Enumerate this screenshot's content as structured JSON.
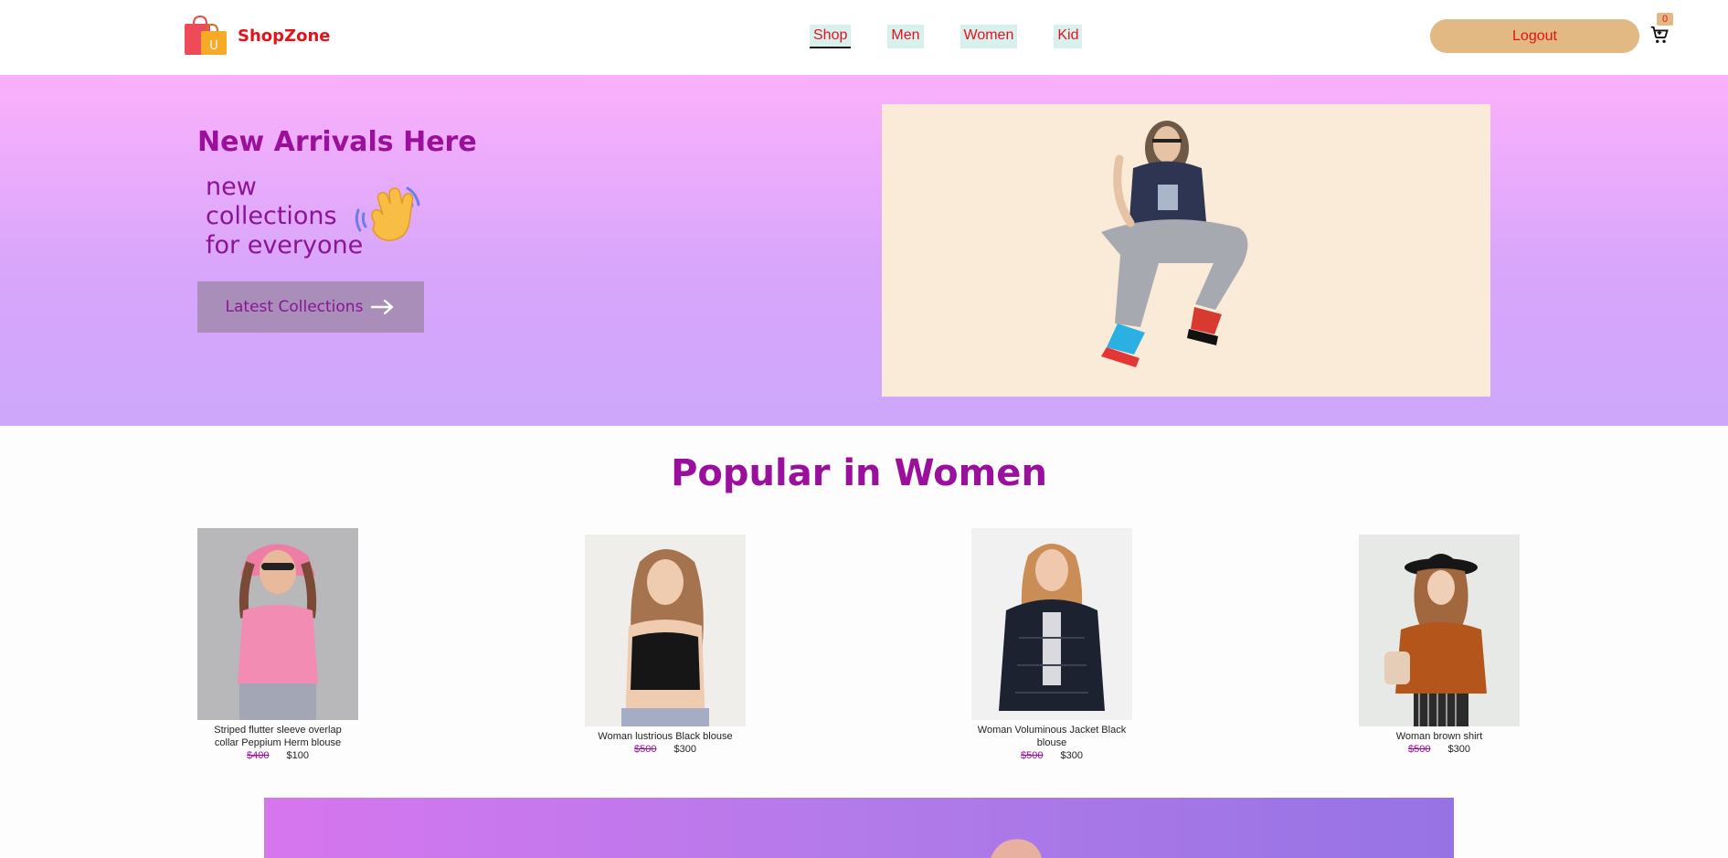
{
  "brand": {
    "name": "ShopZone",
    "logo_letter": "U"
  },
  "nav": {
    "items": [
      {
        "label": "Shop",
        "active": true
      },
      {
        "label": "Men",
        "active": false
      },
      {
        "label": "Women",
        "active": false
      },
      {
        "label": "Kid",
        "active": false
      }
    ],
    "logout_label": "Logout",
    "cart_count": "0"
  },
  "hero": {
    "title": "New Arrivals Here",
    "subtitle_lines": [
      "new",
      "collections",
      "for everyone"
    ],
    "button_label": "Latest Collections"
  },
  "popular": {
    "title": "Popular in Women",
    "products": [
      {
        "name": "Striped flutter sleeve overlap collar Peppium Herm blouse",
        "old_price": "$400",
        "new_price": "$100"
      },
      {
        "name": "Woman lustrious Black blouse",
        "old_price": "$500",
        "new_price": "$300"
      },
      {
        "name": "Woman Voluminous Jacket Black blouse",
        "old_price": "$500",
        "new_price": "$300"
      },
      {
        "name": "Woman brown shirt",
        "old_price": "$500",
        "new_price": "$300"
      }
    ]
  },
  "colors": {
    "brand_red": "#e5121a",
    "accent_purple": "#9a0f9c",
    "nav_bg": "#d8f1ee",
    "logout_bg": "#e2b982"
  }
}
